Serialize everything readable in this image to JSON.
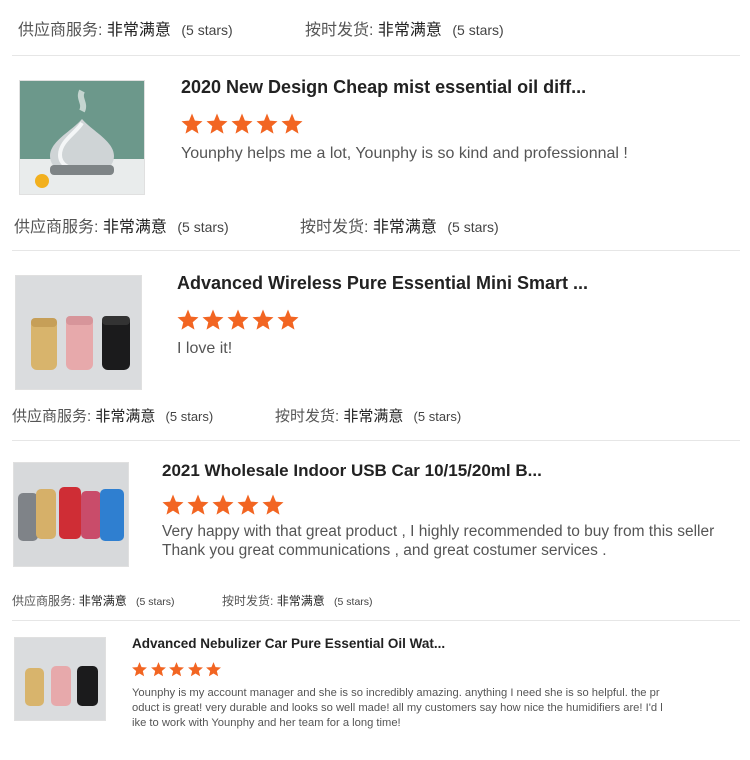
{
  "colors": {
    "star": "#f26522",
    "divider": "#e6e6e6"
  },
  "labels": {
    "supplier_service": "供应商服务:",
    "on_time_delivery": "按时发货:",
    "very_satisfied": "非常满意",
    "five_stars": "(5 stars)"
  },
  "reviews": [
    {
      "title": "2020 New Design Cheap mist essential oil diff...",
      "stars": 5,
      "text": "Younphy helps me a lot, Younphy is so kind and professionnal !",
      "image_icon": "mist-diffuser-product-photo"
    },
    {
      "title": "Advanced Wireless Pure Essential Mini Smart ...",
      "stars": 5,
      "text": "I love it!",
      "image_icon": "car-diffuser-three-colors-photo"
    },
    {
      "title": "2021 Wholesale Indoor USB Car 10/15/20ml B...",
      "stars": 5,
      "text_lines": [
        "Very happy with that  great product , I highly recommended to buy from this seller",
        "Thank you great communications , and great costumer services ."
      ],
      "image_icon": "car-diffuser-five-colors-photo"
    },
    {
      "title": "Advanced Nebulizer Car Pure Essential Oil Wat...",
      "stars": 5,
      "text_lines": [
        "Younphy is my account manager and she is so incredibly amazing. anything I need she is so helpful. the pr",
        "oduct is great! very durable and looks so well made! all my customers say how nice the humidifiers are! I'd l",
        "ike to work with Younphy and her team for a long time!"
      ],
      "image_icon": "car-diffuser-three-colors-photo"
    }
  ]
}
